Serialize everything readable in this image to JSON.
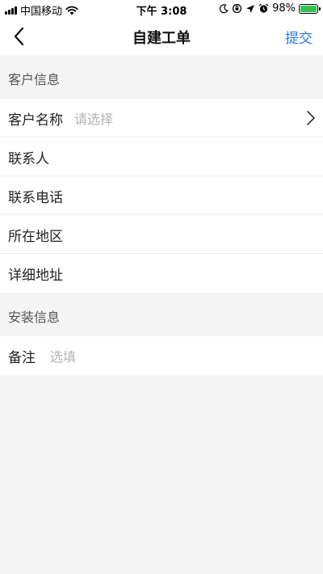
{
  "status_bar": {
    "carrier": "中国移动",
    "time": "下午 3:08",
    "battery_percent": "98%",
    "battery_level": 0.98
  },
  "nav": {
    "title": "自建工单",
    "submit_label": "提交"
  },
  "sections": {
    "customer": {
      "title": "客户信息",
      "name_label": "客户名称",
      "name_placeholder": "请选择",
      "contact_label": "联系人",
      "phone_label": "联系电话",
      "region_label": "所在地区",
      "address_label": "详细地址"
    },
    "install": {
      "title": "安装信息",
      "remark_label": "备注",
      "remark_placeholder": "选填"
    }
  },
  "colors": {
    "accent": "#2a7be4",
    "background": "#f4f4f5",
    "battery": "#33c24d"
  }
}
